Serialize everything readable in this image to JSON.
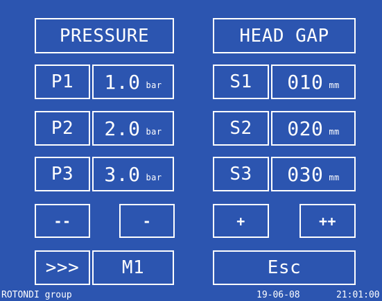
{
  "pressure": {
    "title": "PRESSURE",
    "rows": [
      {
        "label": "P1",
        "value": "1.0",
        "unit": "bar"
      },
      {
        "label": "P2",
        "value": "2.0",
        "unit": "bar"
      },
      {
        "label": "P3",
        "value": "3.0",
        "unit": "bar"
      }
    ],
    "decrease_fast_label": "--",
    "decrease_label": "-"
  },
  "head_gap": {
    "title": "HEAD GAP",
    "rows": [
      {
        "label": "S1",
        "value": "010",
        "unit": "mm"
      },
      {
        "label": "S2",
        "value": "020",
        "unit": "mm"
      },
      {
        "label": "S3",
        "value": "030",
        "unit": "mm"
      }
    ],
    "increase_label": "+",
    "increase_fast_label": "++"
  },
  "footer_controls": {
    "next_label": ">>>",
    "mode_label": "M1",
    "esc_label": "Esc"
  },
  "status_bar": {
    "brand": "ROTONDI group",
    "date": "19-06-08",
    "time": "21:01:00"
  },
  "colors": {
    "background": "#2c55b0",
    "foreground": "#ffffff"
  }
}
